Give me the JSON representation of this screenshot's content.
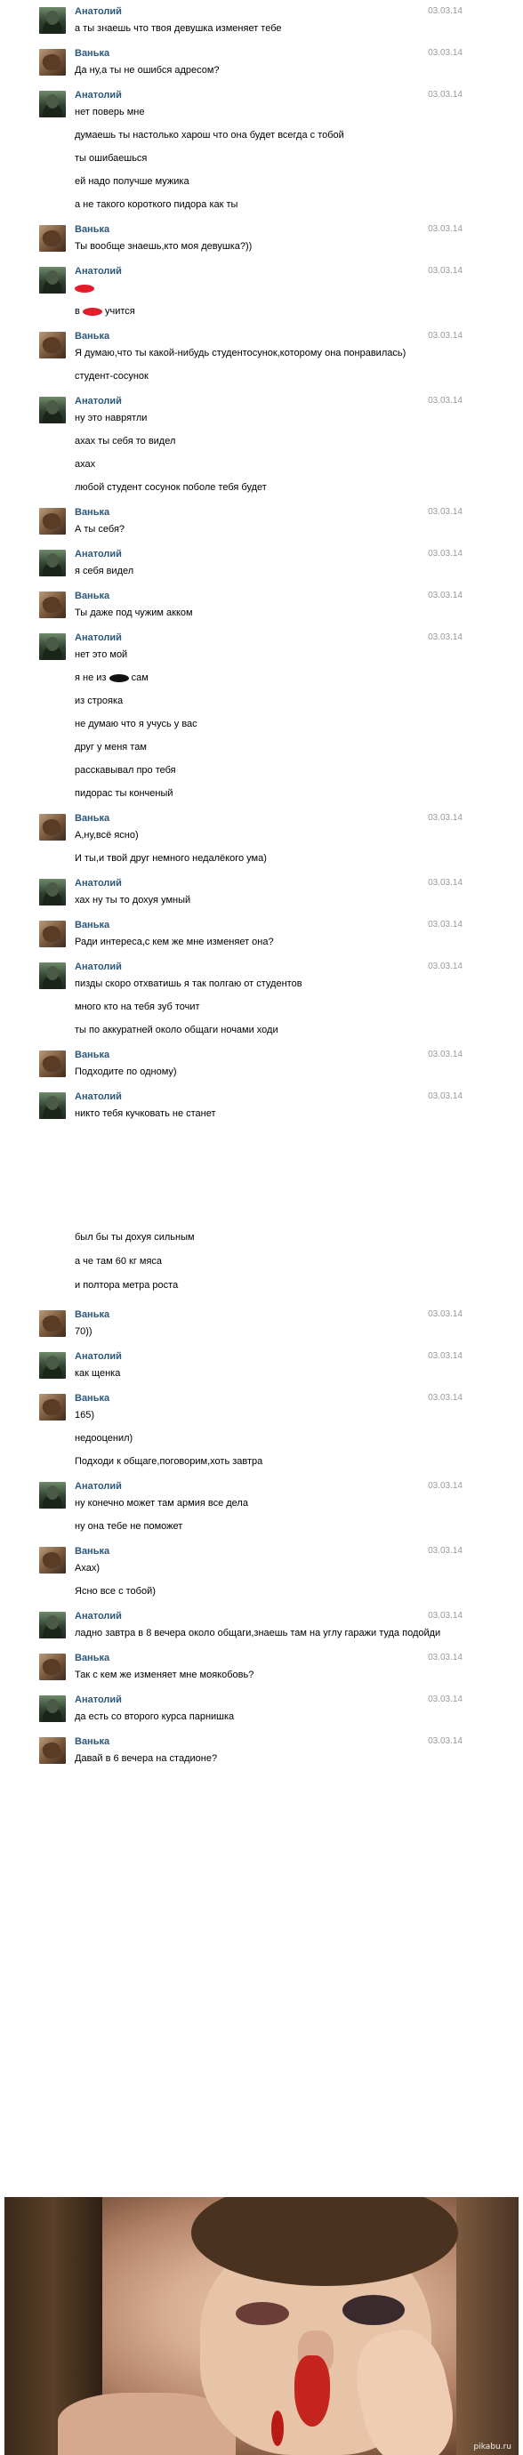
{
  "watermark": "pikabu.ru",
  "chat_top": [
    {
      "author": "Анатолий",
      "avatar": "anatoly",
      "date": "03.03.14",
      "lines": [
        "а ты знаешь что твоя девушка изменяет тебе"
      ]
    },
    {
      "author": "Ванька",
      "avatar": "vanka",
      "date": "03.03.14",
      "lines": [
        "Да ну,а ты не ошибся адресом?"
      ]
    },
    {
      "author": "Анатолий",
      "avatar": "anatoly",
      "date": "03.03.14",
      "lines": [
        "нет поверь мне",
        "думаешь ты настолько харош что она будет всегда с тобой",
        "ты ошибаешься",
        "ей надо получше мужика",
        "а не такого короткого пидора как ты"
      ]
    },
    {
      "author": "Ванька",
      "avatar": "vanka",
      "date": "03.03.14",
      "lines": [
        "Ты вообще знаешь,кто моя девушка?))"
      ]
    },
    {
      "author": "Анатолий",
      "avatar": "anatoly",
      "date": "03.03.14",
      "lines": [
        "[red]",
        "в [red] учится"
      ]
    },
    {
      "author": "Ванька",
      "avatar": "vanka",
      "date": "03.03.14",
      "lines": [
        "Я думаю,что ты какой-нибудь студентосунок,которому она понравилась)",
        "студент-сосунок"
      ]
    },
    {
      "author": "Анатолий",
      "avatar": "anatoly",
      "date": "03.03.14",
      "lines": [
        "ну это наврятли",
        "ахах ты себя то видел",
        "ахах",
        "любой студент сосунок поболе тебя будет"
      ]
    },
    {
      "author": "Ванька",
      "avatar": "vanka",
      "date": "03.03.14",
      "lines": [
        "А ты себя?"
      ]
    },
    {
      "author": "Анатолий",
      "avatar": "anatoly",
      "date": "03.03.14",
      "lines": [
        "я себя видел"
      ]
    },
    {
      "author": "Ванька",
      "avatar": "vanka",
      "date": "03.03.14",
      "lines": [
        "Ты даже под чужим акком"
      ]
    },
    {
      "author": "Анатолий",
      "avatar": "anatoly",
      "date": "03.03.14",
      "lines": [
        "нет это мой",
        "я не из [black] сам",
        "из строяка",
        "не думаю что я учусь у вас",
        "друг у меня там",
        "расскавывал про тебя",
        "пидорас ты конченый"
      ]
    },
    {
      "author": "Ванька",
      "avatar": "vanka",
      "date": "03.03.14",
      "lines": [
        "А,ну,всё ясно)",
        "И ты,и твой друг немного недалёкого ума)"
      ]
    },
    {
      "author": "Анатолий",
      "avatar": "anatoly",
      "date": "03.03.14",
      "lines": [
        "хах ну ты то дохуя умный"
      ]
    },
    {
      "author": "Ванька",
      "avatar": "vanka",
      "date": "03.03.14",
      "lines": [
        "Ради интереса,с кем же мне изменяет она?"
      ]
    },
    {
      "author": "Анатолий",
      "avatar": "anatoly",
      "date": "03.03.14",
      "lines": [
        "пизды скоро отхватишь я так полгаю от студентов",
        "много кто на тебя зуб точит",
        "ты по аккуратней около общаги ночами ходи"
      ]
    },
    {
      "author": "Ванька",
      "avatar": "vanka",
      "date": "03.03.14",
      "lines": [
        "Подходите по одному)"
      ]
    },
    {
      "author": "Анатолий",
      "avatar": "anatoly",
      "date": "03.03.14",
      "lines": [
        "никто тебя кучковать не станет"
      ]
    }
  ],
  "chat_bottom_continuation": [
    "был бы ты дохуя сильным",
    "а че там 60 кг мяса",
    "и полтора метра роста"
  ],
  "chat_bottom": [
    {
      "author": "Ванька",
      "avatar": "vanka",
      "date": "03.03.14",
      "lines": [
        "70))"
      ]
    },
    {
      "author": "Анатолий",
      "avatar": "anatoly",
      "date": "03.03.14",
      "lines": [
        "как щенка"
      ]
    },
    {
      "author": "Ванька",
      "avatar": "vanka",
      "date": "03.03.14",
      "lines": [
        "165)",
        "недооценил)",
        "Подходи к общаге,поговорим,хоть завтра"
      ]
    },
    {
      "author": "Анатолий",
      "avatar": "anatoly",
      "date": "03.03.14",
      "lines": [
        "ну конечно может там армия все дела",
        "ну она тебе не поможет"
      ]
    },
    {
      "author": "Ванька",
      "avatar": "vanka",
      "date": "03.03.14",
      "lines": [
        "Ахах)",
        "Ясно все с тобой)"
      ]
    },
    {
      "author": "Анатолий",
      "avatar": "anatoly",
      "date": "03.03.14",
      "lines": [
        "ладно завтра в 8 вечера около общаги,знаешь там на углу гаражи туда подойди"
      ]
    },
    {
      "author": "Ванька",
      "avatar": "vanka",
      "date": "03.03.14",
      "lines": [
        "Так с кем же изменяет мне моякобовь?"
      ]
    },
    {
      "author": "Анатолий",
      "avatar": "anatoly",
      "date": "03.03.14",
      "lines": [
        "да есть со второго курса парнишка"
      ]
    },
    {
      "author": "Ванька",
      "avatar": "vanka",
      "date": "03.03.14",
      "lines": [
        "Давай в 6 вечера на стадионе?"
      ]
    }
  ]
}
